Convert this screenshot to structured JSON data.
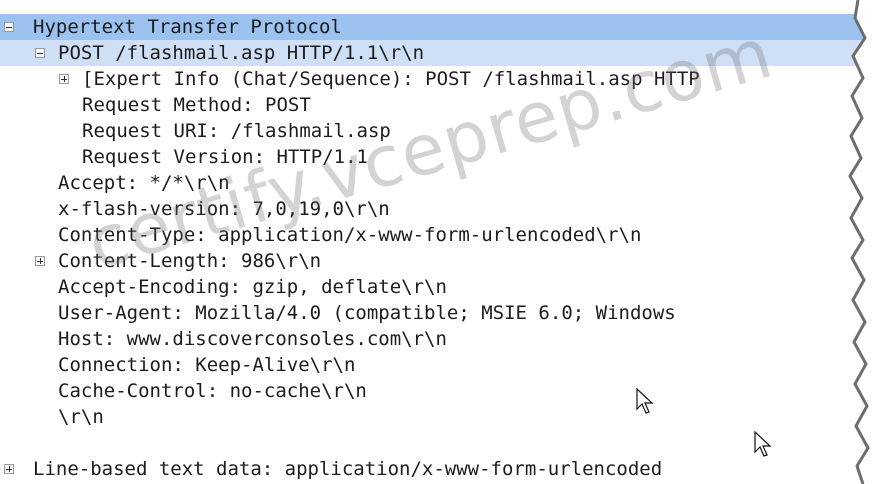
{
  "tree": {
    "http_header": "Hypertext Transfer Protocol",
    "request_line": "POST /flashmail.asp HTTP/1.1\\r\\n",
    "expert_info": "[Expert Info (Chat/Sequence): POST /flashmail.asp HTTP",
    "request_method": "Request Method: POST",
    "request_uri": "Request URI: /flashmail.asp",
    "request_version": "Request Version: HTTP/1.1",
    "accept": "Accept: */*\\r\\n",
    "x_flash_version": "x-flash-version: 7,0,19,0\\r\\n",
    "content_type": "Content-Type: application/x-www-form-urlencoded\\r\\n",
    "content_length": "Content-Length: 986\\r\\n",
    "accept_encoding": "Accept-Encoding: gzip, deflate\\r\\n",
    "user_agent": "User-Agent: Mozilla/4.0 (compatible; MSIE 6.0; Windows",
    "host": "Host: www.discoverconsoles.com\\r\\n",
    "connection": "Connection: Keep-Alive\\r\\n",
    "cache_control": "Cache-Control: no-cache\\r\\n",
    "crlf": "\\r\\n",
    "line_based_text": "Line-based text data: application/x-www-form-urlencoded"
  },
  "watermark": "certify.vceprep.com",
  "colors": {
    "selected_row": "#9cc2ef",
    "selected_row_secondary": "#cfe0f6",
    "text": "#1c1c1c",
    "background": "#ffffff"
  },
  "icons": {
    "expander_open": "minus-box-icon",
    "expander_closed": "plus-box-icon",
    "cursor": "mouse-pointer-icon"
  }
}
